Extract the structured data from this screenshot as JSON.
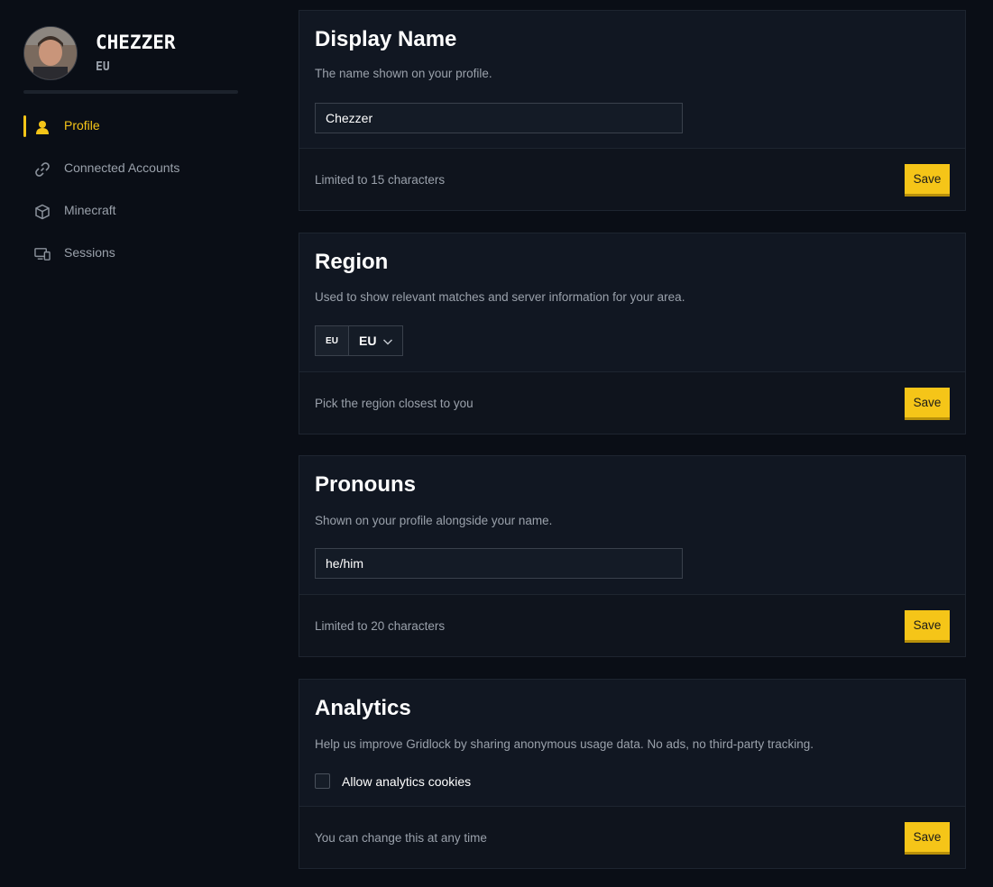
{
  "user": {
    "name": "CHEZZER",
    "region": "EU"
  },
  "nav": {
    "items": [
      {
        "label": "Profile",
        "icon": "user-icon",
        "active": true
      },
      {
        "label": "Connected Accounts",
        "icon": "link-icon",
        "active": false
      },
      {
        "label": "Minecraft",
        "icon": "cube-icon",
        "active": false
      },
      {
        "label": "Sessions",
        "icon": "devices-icon",
        "active": false
      }
    ]
  },
  "display_name": {
    "title": "Display Name",
    "description": "The name shown on your profile.",
    "value": "Chezzer",
    "footer": "Limited to 15 characters",
    "save_label": "Save"
  },
  "region": {
    "title": "Region",
    "description": "Used to show relevant matches and server information for your area.",
    "flag_code": "EU",
    "selected": "EU",
    "footer": "Pick the region closest to you",
    "save_label": "Save"
  },
  "pronouns": {
    "title": "Pronouns",
    "description": "Shown on your profile alongside your name.",
    "value": "he/him",
    "footer": "Limited to 20 characters",
    "save_label": "Save"
  },
  "analytics": {
    "title": "Analytics",
    "description": "Help us improve Gridlock by sharing anonymous usage data. No ads, no third-party tracking.",
    "checkbox_label": "Allow analytics cookies",
    "checked": false,
    "footer": "You can change this at any time",
    "save_label": "Save"
  },
  "colors": {
    "background": "#0a0e16",
    "card": "#111722",
    "accent": "#f5c518",
    "muted_text": "#9aa1ab"
  }
}
